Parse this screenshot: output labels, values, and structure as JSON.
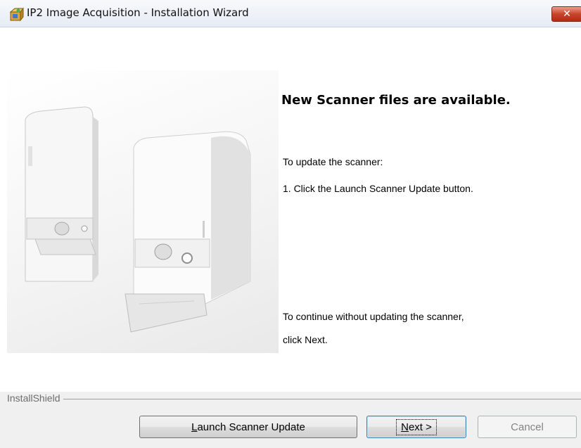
{
  "window": {
    "title": "IP2 Image Acquisition - Installation Wizard",
    "close_label": "✕",
    "app_icon": "installer-box-icon"
  },
  "main": {
    "headline": "New Scanner files are available.",
    "line1": "To update the scanner:",
    "line2": "1. Click the Launch Scanner Update button.",
    "line3": "To continue without updating the scanner,",
    "line4": "click Next.",
    "image": "scanner-product-image"
  },
  "footer": {
    "brand": "InstallShield",
    "launch_update": {
      "mnemonic": "L",
      "rest": "aunch Scanner Update"
    },
    "next": {
      "mnemonic": "N",
      "rest": "ext >"
    },
    "cancel": "Cancel"
  },
  "colors": {
    "title_bar_top": "#f7f9fc",
    "close_button": "#c7442a",
    "footer_bg": "#f0f0f0",
    "default_button_border": "#3c7fb1"
  }
}
